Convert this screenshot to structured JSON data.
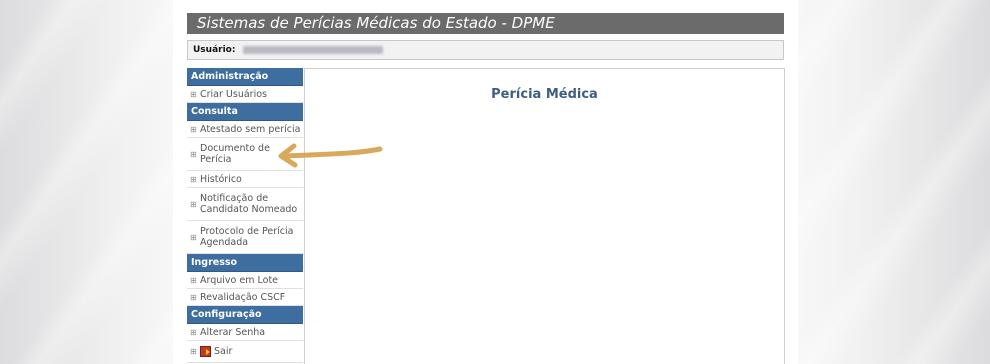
{
  "header": {
    "title": "Sistemas de Perícias Médicas do Estado - DPME"
  },
  "user": {
    "label": "Usuário:"
  },
  "sidebar": {
    "sections": [
      {
        "title": "Administração",
        "items": [
          "Criar Usuários"
        ]
      },
      {
        "title": "Consulta",
        "items": [
          "Atestado sem perícia",
          "Documento de Perícia",
          "Histórico",
          "Notificação de Candidato Nomeado",
          "Protocolo de Perícia Agendada"
        ]
      },
      {
        "title": "Ingresso",
        "items": [
          "Arquivo em Lote",
          "Revalidação CSCF"
        ]
      },
      {
        "title": "Configuração",
        "items": [
          "Alterar Senha",
          "Sair"
        ]
      }
    ]
  },
  "main": {
    "title": "Perícia Médica"
  },
  "icons": {
    "expand": "plus-box-icon",
    "exit": "exit-door-icon",
    "annotation": "curved-arrow-annotation"
  },
  "colors": {
    "section_header": "#3e6e9f",
    "title_bar": "#6b6b6b",
    "arrow": "#d8a95a",
    "main_title": "#3e5f83"
  }
}
